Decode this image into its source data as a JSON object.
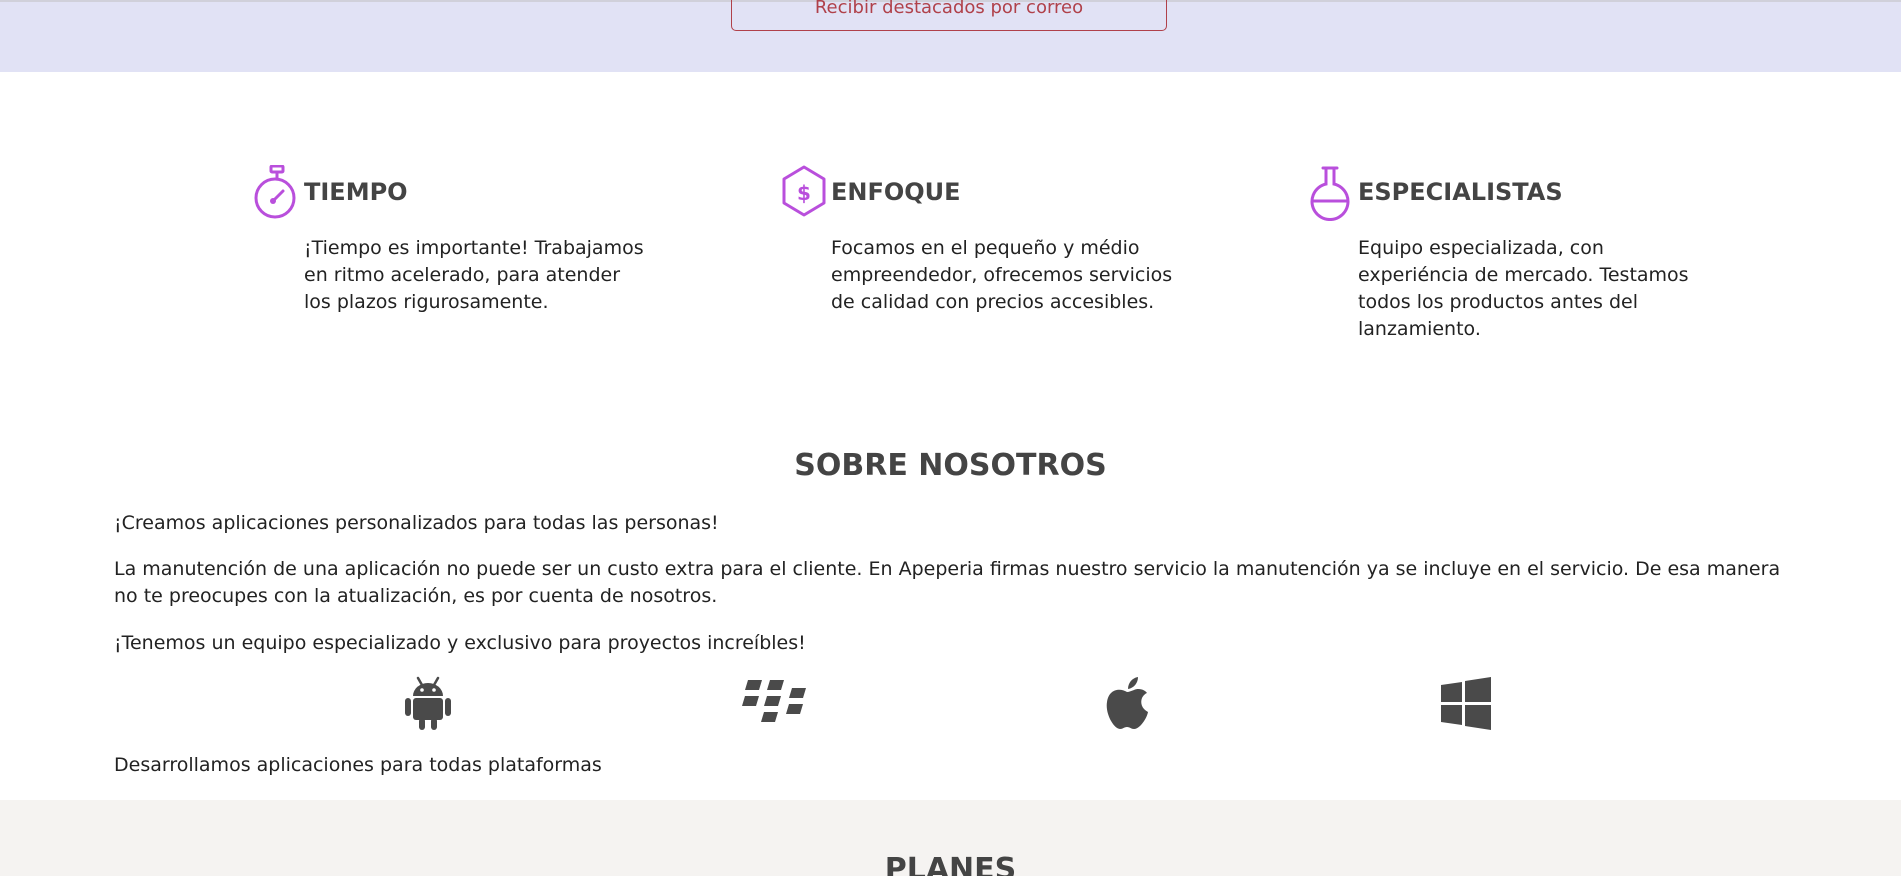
{
  "newsletter": {
    "button_label": "Recibir destacados por correo"
  },
  "features": [
    {
      "icon": "stopwatch-icon",
      "title": "TIEMPO",
      "description": "¡Tiempo es importante! Trabajamos en ritmo acelerado, para atender los plazos rigurosamente."
    },
    {
      "icon": "dollar-hexagon-icon",
      "title": "ENFOQUE",
      "description": "Focamos en el pequeño y médio empreendedor, ofrecemos servicios de calidad con precios accesibles."
    },
    {
      "icon": "flask-icon",
      "title": "ESPECIALISTAS",
      "description": "Equipo especializada, con experiéncia de mercado. Testamos todos los productos antes del lanzamiento."
    }
  ],
  "about": {
    "title": "SOBRE NOSOTROS",
    "paragraph_1": "¡Creamos aplicaciones personalizados para todas las personas!",
    "paragraph_2": "La manutención de una aplicación no puede ser un custo extra para el cliente. En Apeperia firmas nuestro servicio la manutención ya se incluye en el servicio. De esa manera no te preocupes con la atualización, es por cuenta de nosotros.",
    "paragraph_3": "¡Tenemos un equipo especializado y exclusivo para proyectos increíbles!",
    "platforms": [
      "android-icon",
      "blackberry-icon",
      "apple-icon",
      "windows-icon"
    ],
    "platforms_caption": "Desarrollamos aplicaciones para todas plataformas"
  },
  "plans": {
    "title": "PLANES"
  },
  "colors": {
    "accent_purple": "#b94fdc",
    "button_border": "#b0414a",
    "top_band": "#e1e2f5",
    "bottom_band": "#f5f3f1",
    "heading": "#444444",
    "platform_icon": "#4a4a4a"
  }
}
